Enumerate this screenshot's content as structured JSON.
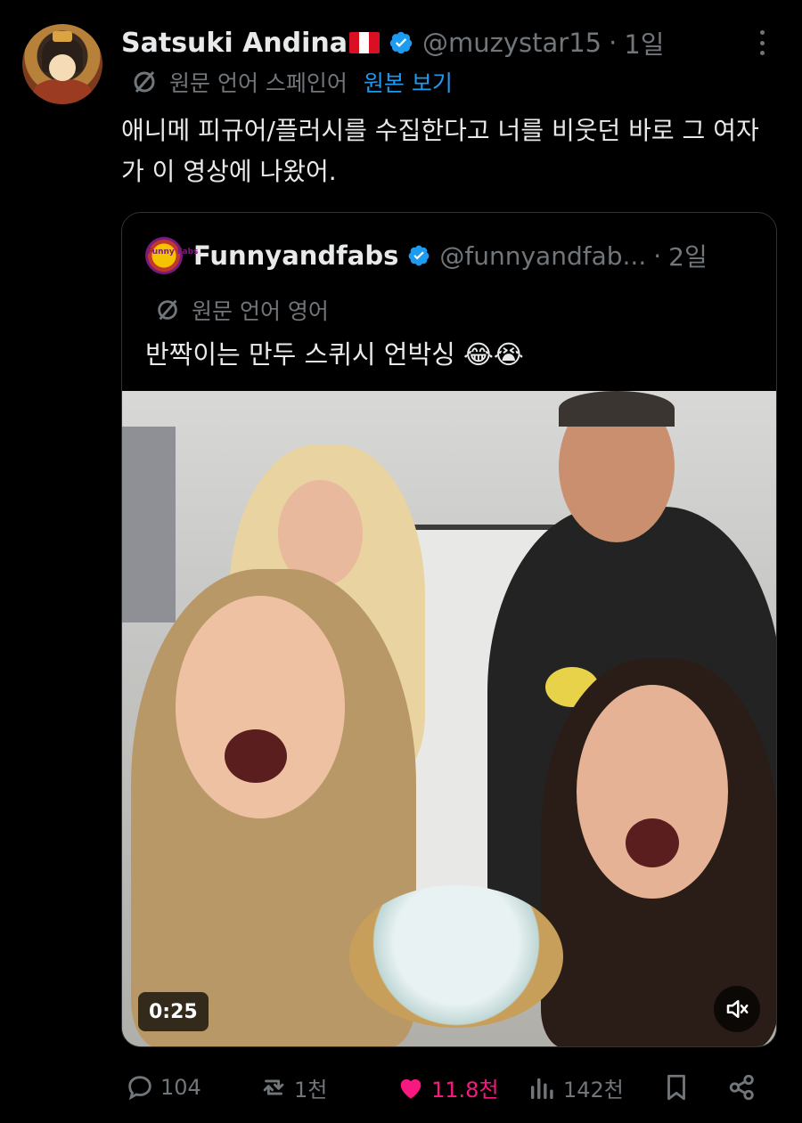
{
  "post": {
    "author_name": "Satsuki Andina",
    "handle": "@muzystar15",
    "separator": "·",
    "time": "1일",
    "translation": {
      "original_language": "원문 언어 스페인어",
      "show_original": "원본 보기"
    },
    "text": "애니메 피규어/플러시를 수집한다고 너를 비웃던 바로 그 여자가 이 영상에 나왔어."
  },
  "quote": {
    "avatar_text": "Funny Fabs",
    "author_name": "Funnyandfabs",
    "handle": "@funnyandfab...",
    "separator": "·",
    "time": "2일",
    "original_language": "원문 언어 영어",
    "text": "반짝이는 만두 스퀴시 언박싱 😂😭",
    "video": {
      "timecode": "0:25"
    }
  },
  "actions": {
    "replies": "104",
    "reposts": "1천",
    "likes": "11.8천",
    "views": "142천"
  },
  "colors": {
    "background": "#000000",
    "text": "#e7e9ea",
    "muted": "#71767b",
    "link": "#1d9bf0",
    "like": "#f91880",
    "verified": "#1d9bf0"
  }
}
